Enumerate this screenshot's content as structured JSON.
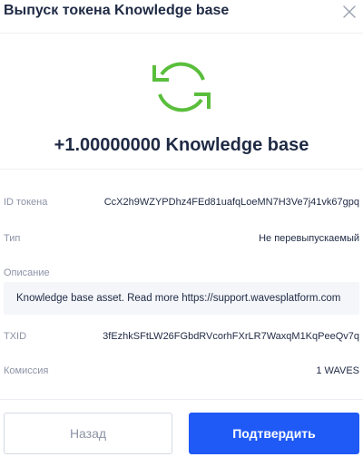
{
  "header": {
    "title": "Выпуск токена Knowledge base",
    "close_icon": "close-icon"
  },
  "hero": {
    "icon": "refresh-icon",
    "icon_color": "#5abe3c",
    "amount": "+1.00000000 Knowledge base"
  },
  "details": {
    "token_id_label": "ID токена",
    "token_id": "CcX2h9WZYPDhz4FEd81uafqLoeMN7H3Ve7j41vk67gpq",
    "type_label": "Тип",
    "type_value": "Не перевыпускаемый",
    "description_label": "Описание",
    "description": "Knowledge base asset. Read more https://support.wavesplatform.com",
    "txid_label": "TXID",
    "txid": "3fEzhkSFtLW26FGbdRVcorhFXrLR7WaxqM1KqPeeQv7q",
    "fee_label": "Комиссия",
    "fee_value": "1 WAVES"
  },
  "actions": {
    "back_label": "Назад",
    "confirm_label": "Подтвердить"
  },
  "colors": {
    "accent": "#1f5af6",
    "success": "#5abe3c",
    "muted_text": "#8c93a6",
    "primary_text": "#1f2a44"
  }
}
